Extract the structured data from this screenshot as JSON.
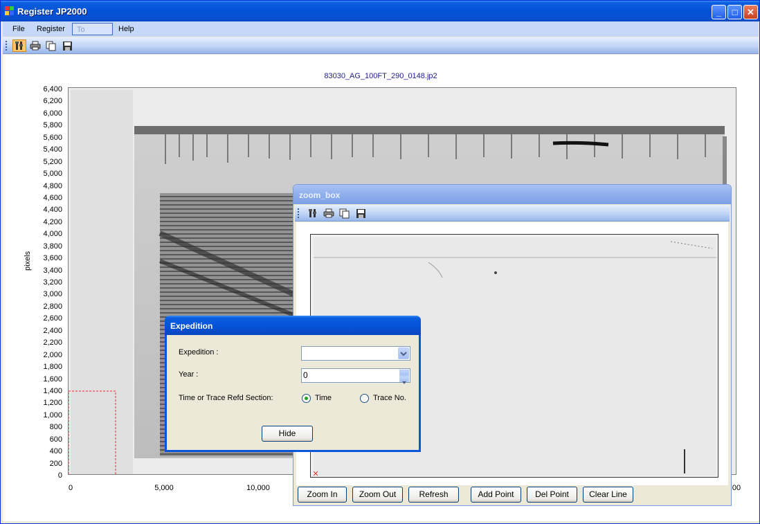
{
  "window": {
    "title": "Register JP2000"
  },
  "menu": {
    "items": [
      "File",
      "Register",
      "To SEGY",
      "Help"
    ]
  },
  "plot": {
    "title": "83030_AG_100FT_290_0148.jp2",
    "ylabel": "pixels",
    "yticks": [
      "6,400",
      "6,200",
      "6,000",
      "5,800",
      "5,600",
      "5,400",
      "5,200",
      "5,000",
      "4,800",
      "4,600",
      "4,400",
      "4,200",
      "4,000",
      "3,800",
      "3,600",
      "3,400",
      "3,200",
      "3,000",
      "2,800",
      "2,600",
      "2,400",
      "2,200",
      "2,000",
      "1,800",
      "1,600",
      "1,400",
      "1,200",
      "1,000",
      "800",
      "600",
      "400",
      "200",
      "0"
    ],
    "xticks": [
      "0",
      "5,000",
      "10,000",
      "00"
    ]
  },
  "zoom": {
    "title": "zoom_box",
    "buttons": [
      "Zoom In",
      "Zoom Out",
      "Refresh",
      "Add Point",
      "Del Point",
      "Clear Line"
    ]
  },
  "expedition": {
    "title": "Expedition",
    "expedition_label": "Expedition :",
    "expedition_value": "",
    "year_label": "Year  :",
    "year_value": "0",
    "section_label": "Time or Trace Refd Section:",
    "time_label": "Time",
    "trace_label": "Trace No.",
    "selected": "Time",
    "hide_label": "Hide"
  },
  "colors": {
    "titlebar": "#0553d6",
    "accent": "#21a121"
  }
}
